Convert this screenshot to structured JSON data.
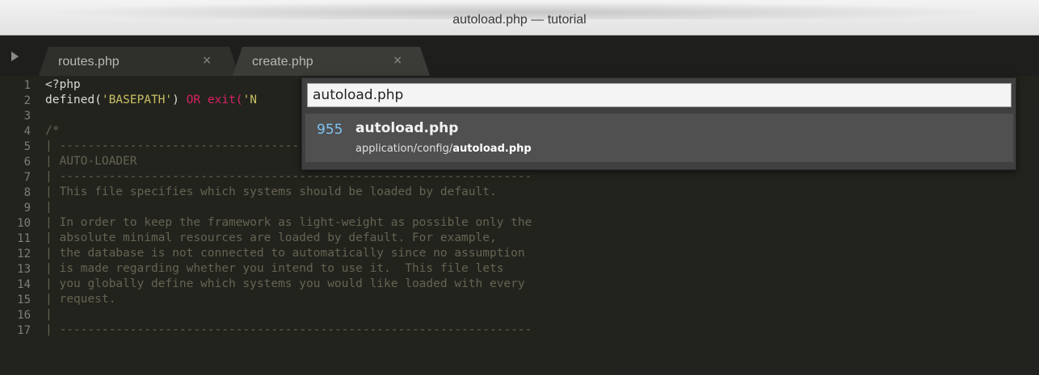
{
  "window": {
    "title": "autoload.php — tutorial"
  },
  "tabs": [
    {
      "label": "routes.php",
      "close": "×"
    },
    {
      "label": "create.php",
      "close": "×"
    }
  ],
  "editor": {
    "line_numbers": [
      "1",
      "2",
      "3",
      "4",
      "5",
      "6",
      "7",
      "8",
      "9",
      "10",
      "11",
      "12",
      "13",
      "14",
      "15",
      "16",
      "17"
    ],
    "lines": {
      "l1": "<?php",
      "l2_fn": "defined(",
      "l2_str": "'BASEPATH'",
      "l2_mid": ") ",
      "l2_or": "OR",
      "l2_exit": "exit(",
      "l2_tail": "'N",
      "l4": "/*",
      "l5": "| -------------------------------------------------------------------",
      "l6": "| AUTO-LOADER",
      "l7": "| -------------------------------------------------------------------",
      "l8": "| This file specifies which systems should be loaded by default.",
      "l9": "|",
      "l10": "| In order to keep the framework as light-weight as possible only the",
      "l11": "| absolute minimal resources are loaded by default. For example,",
      "l12": "| the database is not connected to automatically since no assumption",
      "l13": "| is made regarding whether you intend to use it.  This file lets",
      "l14": "| you globally define which systems you would like loaded with every",
      "l15": "| request.",
      "l16": "|",
      "l17": "| -------------------------------------------------------------------"
    }
  },
  "palette": {
    "query": "autoload.php",
    "results": [
      {
        "count": "955",
        "name": "autoload.php",
        "path_prefix": "application/config/",
        "path_match": "autoload.php"
      }
    ]
  },
  "colors": {
    "background": "#272822",
    "comment": "#75715e",
    "keyword": "#f92672",
    "string": "#e6db74",
    "accent": "#7ec4f2"
  }
}
